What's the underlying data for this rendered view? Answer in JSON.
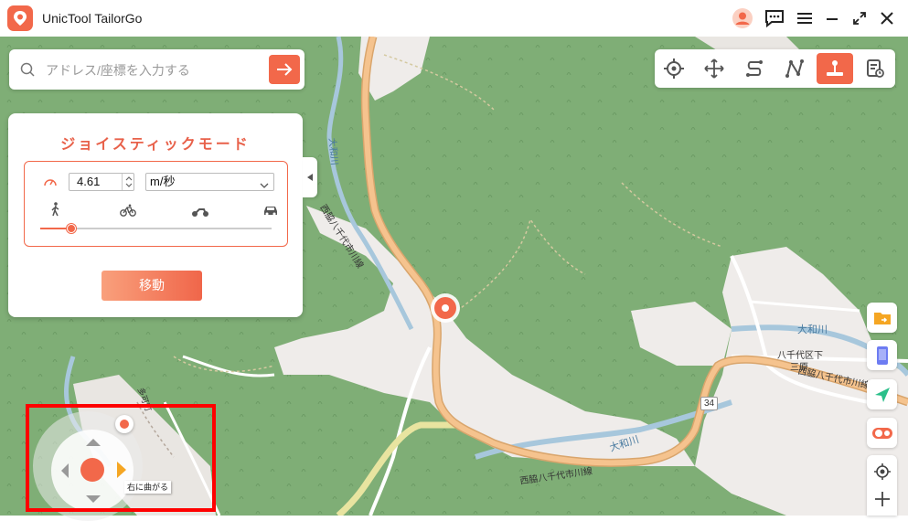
{
  "app": {
    "title": "UnicTool TailorGo"
  },
  "search": {
    "placeholder": "アドレス/座標を入力する",
    "value": ""
  },
  "joystick_panel": {
    "title": "ジョイスティックモード",
    "speed_value": "4.61",
    "speed_unit": "m/秒",
    "speed_fraction": 0.13,
    "move_button": "移動"
  },
  "joystick": {
    "tooltip": "右に曲がる"
  },
  "map_labels": {
    "road_main": "西脇八千代市川線",
    "road_main_2": "西脇八千代市川線",
    "road_main_3": "西脇八千代市川線",
    "river_1": "大和川",
    "river_2": "大和川",
    "river_3": "大和川",
    "area": "八千代区下",
    "area_2": "三原",
    "route_number": "34",
    "side_road": "多可町"
  },
  "colors": {
    "accent": "#f2684a",
    "map_green": "#7fae76",
    "road": "#f5c38e",
    "highlight_frame": "#ff0000"
  }
}
